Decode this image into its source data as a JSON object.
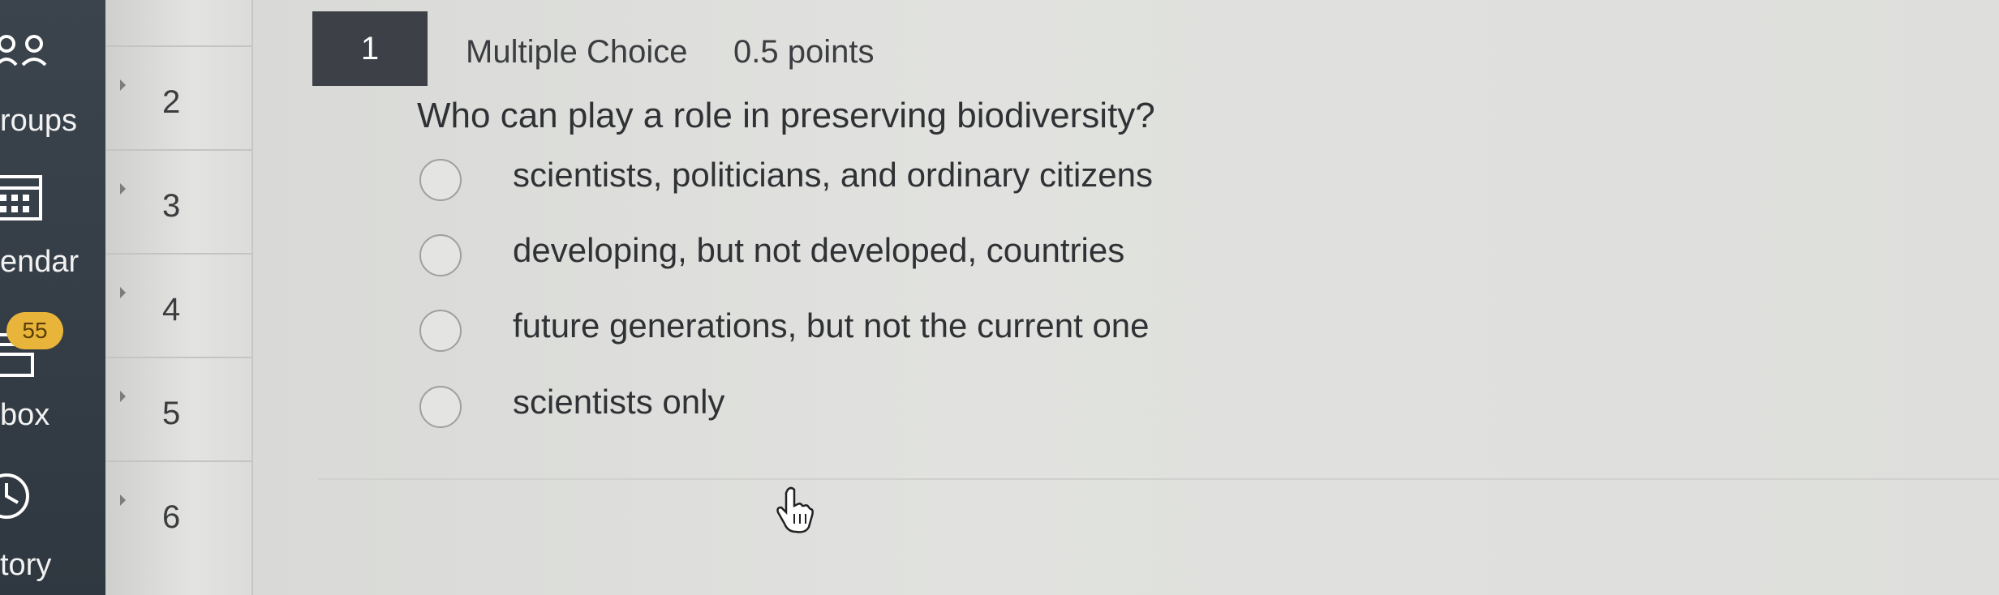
{
  "global_nav": {
    "items": [
      {
        "label": "roups",
        "icon": "groups-icon"
      },
      {
        "label": "endar",
        "icon": "calendar-icon"
      },
      {
        "label": "box",
        "icon": "inbox-icon",
        "badge": "55"
      },
      {
        "label": "tory",
        "icon": "history-icon"
      }
    ]
  },
  "question_nav": {
    "numbers": [
      "2",
      "3",
      "4",
      "5",
      "6"
    ]
  },
  "question": {
    "number": "1",
    "type": "Multiple Choice",
    "points": "0.5 points",
    "text": "Who can play a role in preserving biodiversity?",
    "answers": [
      "scientists, politicians, and ordinary citizens",
      "developing, but not developed, countries",
      "future generations, but not the current one",
      "scientists only"
    ]
  },
  "colors": {
    "nav_bg": "#343c45",
    "badge": "#e9b43a",
    "question_number_bg": "#3d4046",
    "page_bg": "#dedfdc"
  }
}
